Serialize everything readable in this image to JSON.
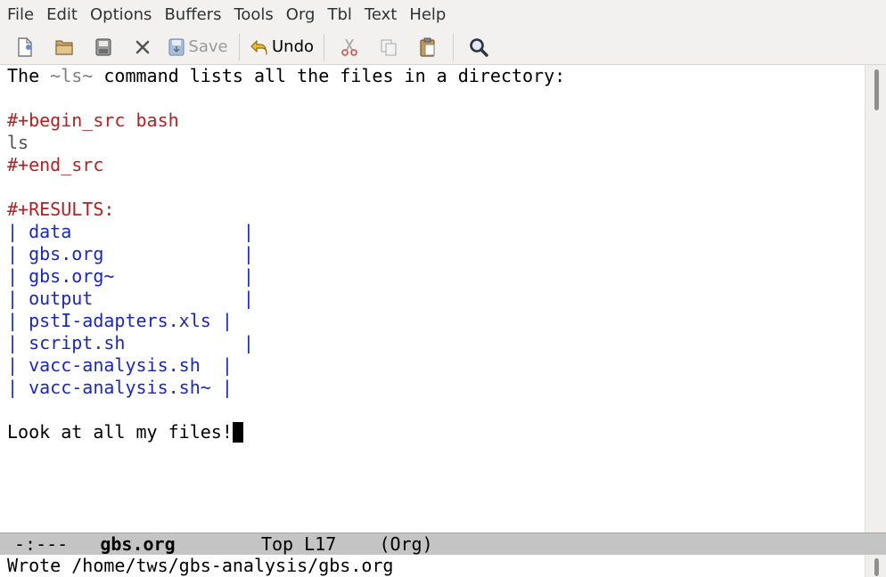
{
  "menu": {
    "items": [
      "File",
      "Edit",
      "Options",
      "Buffers",
      "Tools",
      "Org",
      "Tbl",
      "Text",
      "Help"
    ]
  },
  "toolbar": {
    "save_label": "Save",
    "undo_label": "Undo",
    "icons": [
      "new-file-icon",
      "open-file-icon",
      "save-as-icon",
      "close-icon",
      "save-icon",
      "undo-icon",
      "cut-icon",
      "copy-icon",
      "paste-icon",
      "search-icon"
    ]
  },
  "buffer": {
    "line1": {
      "pre": "The ",
      "code": "~ls~",
      "post": " command lists all the files in a directory:"
    },
    "begin_src": "#+begin_src bash",
    "src_body": "ls",
    "end_src": "#+end_src",
    "results": "#+RESULTS:",
    "table_rows": [
      "| data                |",
      "| gbs.org             |",
      "| gbs.org~            |",
      "| output              |",
      "| pstI-adapters.xls |",
      "| script.sh           |",
      "| vacc-analysis.sh  |",
      "| vacc-analysis.sh~ |"
    ],
    "last_line": "Look at all my files!"
  },
  "modeline": {
    "status": "-:---",
    "buffer_name": "gbs.org",
    "position": "Top L17",
    "mode": "(Org)"
  },
  "echo": {
    "message": "Wrote /home/tws/gbs-analysis/gbs.org"
  },
  "colors": {
    "meta": "#b22222",
    "table": "#1a28b8",
    "code": "#7f7f7f",
    "modeline_bg": "#c4c4c4"
  }
}
